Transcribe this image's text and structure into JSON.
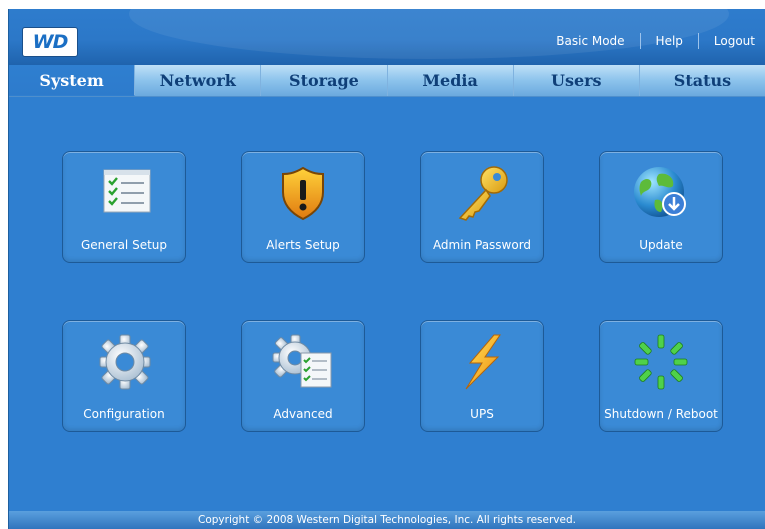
{
  "brand": {
    "logo_text": "WD"
  },
  "toplinks": {
    "basic_mode": "Basic Mode",
    "help": "Help",
    "logout": "Logout"
  },
  "tabs": [
    {
      "label": "System",
      "active": true
    },
    {
      "label": "Network"
    },
    {
      "label": "Storage"
    },
    {
      "label": "Media"
    },
    {
      "label": "Users"
    },
    {
      "label": "Status"
    }
  ],
  "tiles": {
    "general_setup": "General Setup",
    "alerts_setup": "Alerts Setup",
    "admin_password": "Admin Password",
    "update": "Update",
    "configuration": "Configuration",
    "advanced": "Advanced",
    "ups": "UPS",
    "shutdown_reboot": "Shutdown / Reboot"
  },
  "footer": {
    "copyright": "Copyright © 2008 Western Digital Technologies, Inc. All rights reserved."
  },
  "colors": {
    "background": "#2f7fd0",
    "tab_bar": "#8cc3ec",
    "tab_text": "#0f3f78",
    "tile": "#3a8ad6"
  }
}
